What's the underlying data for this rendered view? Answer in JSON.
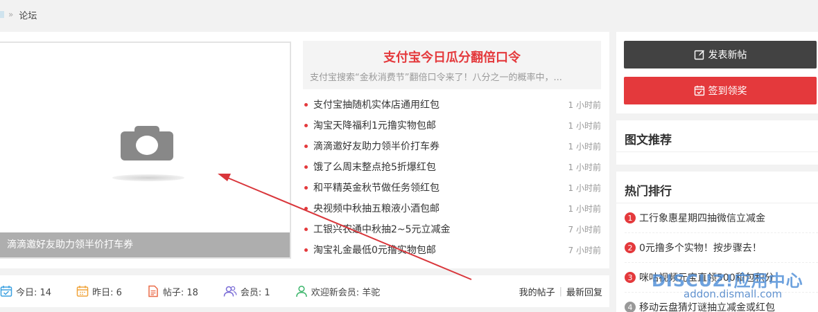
{
  "breadcrumb": {
    "separator": "»",
    "current": "论坛"
  },
  "slideshow": {
    "caption": "滴滴邀好友助力领半价打车券",
    "placeholder_icon": "camera-icon"
  },
  "headline": {
    "title": "支付宝今日瓜分翻倍口令",
    "summary": "支付宝搜索“金秋消费节”翻倍口令来了！八分之一的概率中，..."
  },
  "news": [
    {
      "title": "支付宝抽随机实体店通用红包",
      "time": "1 小时前"
    },
    {
      "title": "淘宝天降福利1元撸实物包邮",
      "time": "1 小时前"
    },
    {
      "title": "滴滴邀好友助力领半价打车券",
      "time": "1 小时前"
    },
    {
      "title": "饿了么周末整点抢5折爆红包",
      "time": "1 小时前"
    },
    {
      "title": "和平精英金秋节做任务领红包",
      "time": "1 小时前"
    },
    {
      "title": "央视频中秋抽五粮液小酒包邮",
      "time": "1 小时前"
    },
    {
      "title": "工银兴农通中秋抽2~5元立减金",
      "time": "7 小时前"
    },
    {
      "title": "淘宝礼金最低0元撸实物包邮",
      "time": "7 小时前"
    }
  ],
  "stats": {
    "today": "今日: 14",
    "yesterday": "昨日: 6",
    "posts": "帖子: 18",
    "members": "会员: 1",
    "newest_member": "欢迎新会员: 羊驼",
    "my_posts": "我的帖子",
    "link_divider": "|",
    "latest_replies": "最新回复"
  },
  "actions": {
    "post_label": "发表新帖",
    "sign_label": "签到领奖"
  },
  "sidebar": {
    "recommend_title": "图文推荐",
    "hot_title": "热门排行",
    "hot": [
      {
        "rank": "1",
        "title": "工行象惠星期四抽微信立减金"
      },
      {
        "rank": "2",
        "title": "0元撸多个实物！按步骤去！"
      },
      {
        "rank": "3",
        "title": "咪咕视频元宝直领500和包积分"
      },
      {
        "rank": "4",
        "title": "移动云盘猜灯谜抽立减金或红包"
      }
    ]
  },
  "watermark": {
    "brand": "DISCUZ!应用中心",
    "url": "addon.dismall.com"
  },
  "colors": {
    "accent_red": "#e4393c",
    "dark_button": "#424242"
  }
}
